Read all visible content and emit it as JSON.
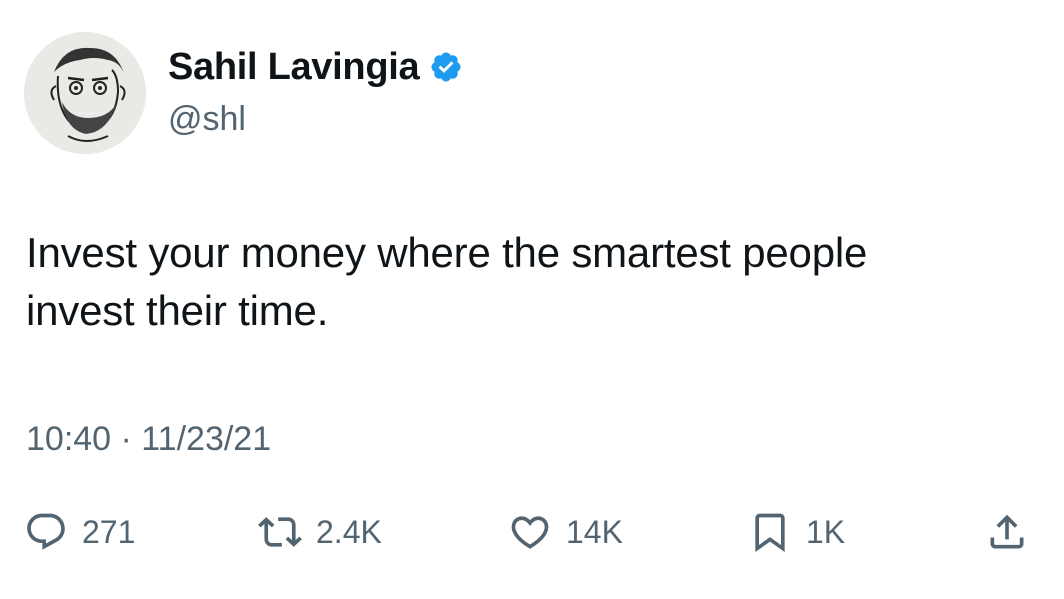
{
  "author": {
    "display_name": "Sahil Lavingia",
    "handle": "@shl",
    "verified": true,
    "verified_color": "#1d9bf0"
  },
  "tweet": {
    "text_line1": "Invest your money where the smartest people",
    "text_line2": "invest their time.",
    "timestamp": "10:40 · 11/23/21"
  },
  "actions": {
    "replies": {
      "icon": "reply-icon",
      "count": "271"
    },
    "retweets": {
      "icon": "retweet-icon",
      "count": "2.4K"
    },
    "likes": {
      "icon": "heart-icon",
      "count": "14K"
    },
    "bookmarks": {
      "icon": "bookmark-icon",
      "count": "1K"
    },
    "share": {
      "icon": "share-icon"
    }
  },
  "colors": {
    "text_primary": "#0f1419",
    "text_secondary": "#536471",
    "background": "#ffffff"
  }
}
